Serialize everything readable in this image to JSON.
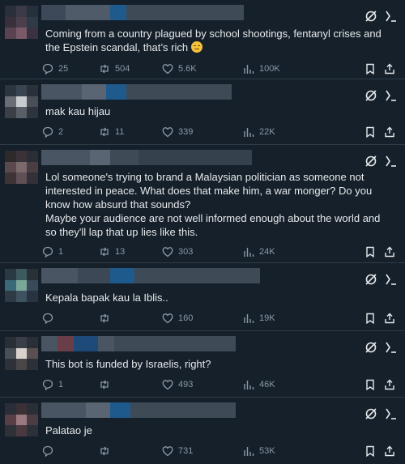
{
  "replies": [
    {
      "text": "Coming from a country plagued by school shootings, fentanyl crises and the Epstein scandal, that’s rich",
      "has_emoji": true,
      "emoji_name": "unamused-face-emoji",
      "replies": "25",
      "reposts": "504",
      "likes": "5.6K",
      "views": "100K"
    },
    {
      "text": "mak kau hijau",
      "replies": "2",
      "reposts": "11",
      "likes": "339",
      "views": "22K"
    },
    {
      "text": "Lol someone's trying to brand a Malaysian politician as someone not interested in peace. What does that make him, a war monger? Do you know how absurd that sounds?\nMaybe your audience are not well informed enough about the world and so they'll lap that up lies like this.",
      "replies": "1",
      "reposts": "13",
      "likes": "303",
      "views": "24K"
    },
    {
      "text": "Kepala bapak kau la Iblis..",
      "replies": "",
      "reposts": "",
      "likes": "160",
      "views": "19K"
    },
    {
      "text": "This bot is funded by Israelis, right?",
      "replies": "1",
      "reposts": "",
      "likes": "493",
      "views": "46K"
    },
    {
      "text": "Palatao je",
      "replies": "",
      "reposts": "",
      "likes": "731",
      "views": "53K"
    }
  ],
  "colors": {
    "background": "#15202b",
    "divider": "#2f3b47",
    "text": "#e7e9ea",
    "muted": "#8b98a5"
  },
  "icons": [
    "grok-icon",
    "more-options-icon",
    "reply-icon",
    "repost-icon",
    "like-icon",
    "views-icon",
    "bookmark-icon",
    "share-icon"
  ]
}
